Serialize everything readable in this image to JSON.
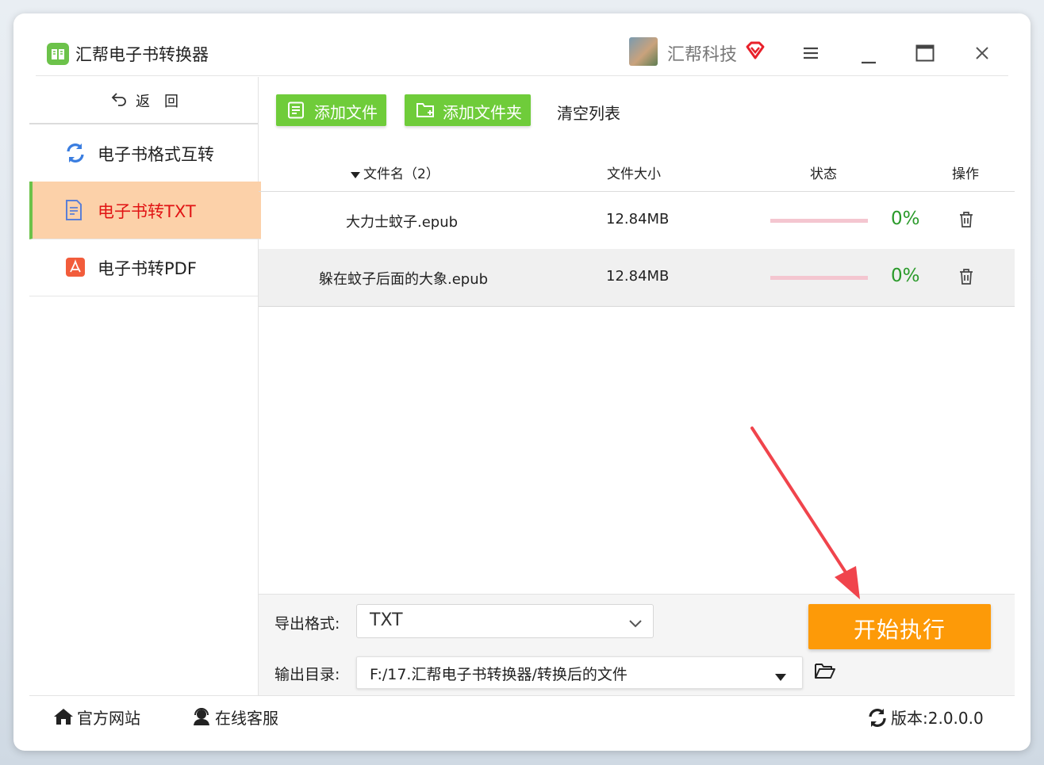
{
  "app": {
    "title": "汇帮电子书转换器",
    "brand": "汇帮科技"
  },
  "sidebar": {
    "back_label": "返回",
    "items": [
      {
        "label": "电子书格式互转",
        "icon": "refresh-icon",
        "active": false
      },
      {
        "label": "电子书转TXT",
        "icon": "document-icon",
        "active": true
      },
      {
        "label": "电子书转PDF",
        "icon": "pdf-icon",
        "active": false
      }
    ]
  },
  "toolbar": {
    "add_file": "添加文件",
    "add_folder": "添加文件夹",
    "clear_list": "清空列表"
  },
  "table": {
    "headers": {
      "name": "文件名（2）",
      "size": "文件大小",
      "status": "状态",
      "action": "操作"
    },
    "rows": [
      {
        "name": "大力士蚊子.epub",
        "size": "12.84MB",
        "progress": 0,
        "percent": "0%"
      },
      {
        "name": "躲在蚊子后面的大象.epub",
        "size": "12.84MB",
        "progress": 0,
        "percent": "0%"
      }
    ]
  },
  "output": {
    "format_label": "导出格式:",
    "format_value": "TXT",
    "dir_label": "输出目录:",
    "dir_value": "F:/17.汇帮电子书转换器/转换后的文件"
  },
  "start_button": "开始执行",
  "footer": {
    "website": "官方网站",
    "support": "在线客服",
    "version_label": "版本:",
    "version": "2.0.0.0"
  },
  "colors": {
    "accent_green": "#6fcc3a",
    "active_bg": "#fcd1a9",
    "active_text": "#e11414",
    "start_orange": "#fd9a08",
    "percent_green": "#2a9a2a",
    "annotation_red": "#f0444c"
  }
}
